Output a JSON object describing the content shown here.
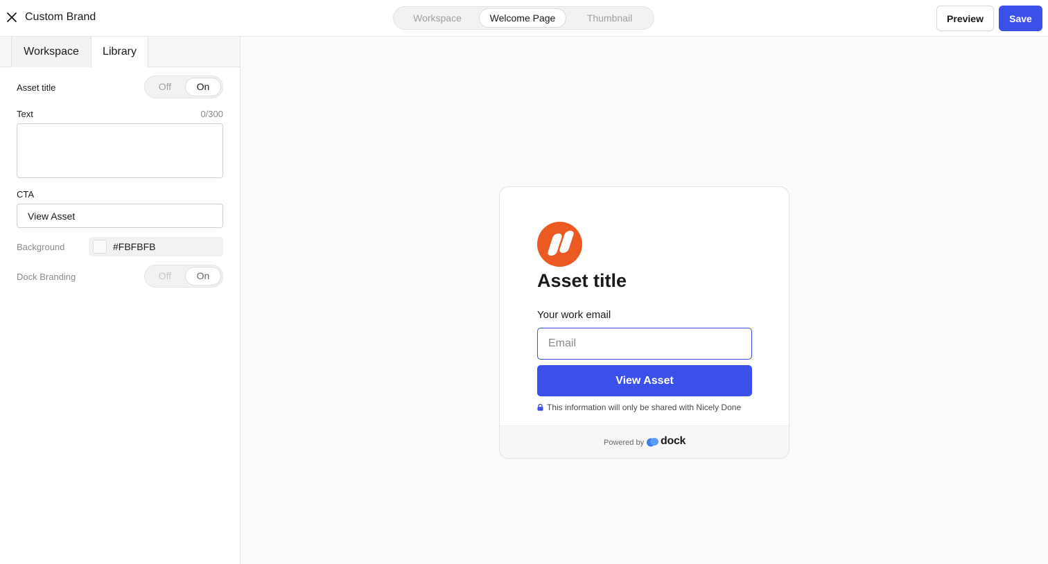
{
  "header": {
    "title": "Custom Brand",
    "segments": [
      "Workspace",
      "Welcome Page",
      "Thumbnail"
    ],
    "active_segment": "Welcome Page",
    "preview_label": "Preview",
    "save_label": "Save"
  },
  "sidebar": {
    "tabs": [
      "Workspace",
      "Library"
    ],
    "active_tab": "Library",
    "asset_title": {
      "label": "Asset title",
      "off": "Off",
      "on": "On",
      "value": "On"
    },
    "text": {
      "label": "Text",
      "counter": "0/300",
      "value": ""
    },
    "cta": {
      "label": "CTA",
      "value": "View Asset"
    },
    "background": {
      "label": "Background",
      "value": "#FBFBFB"
    },
    "dock_branding": {
      "label": "Dock Branding",
      "off": "Off",
      "on": "On",
      "value": "On",
      "disabled": true
    }
  },
  "preview": {
    "title": "Asset title",
    "email_label": "Your work email",
    "email_placeholder": "Email",
    "cta_label": "View Asset",
    "notice": "This information will only be shared with Nicely Done",
    "powered_by": "Powered by",
    "brand": "dock"
  },
  "colors": {
    "accent": "#3b50e8",
    "logo": "#ec5a24",
    "background": "#FBFBFB"
  },
  "icons": [
    "close-icon",
    "lock-icon",
    "dock-logo-icon"
  ]
}
